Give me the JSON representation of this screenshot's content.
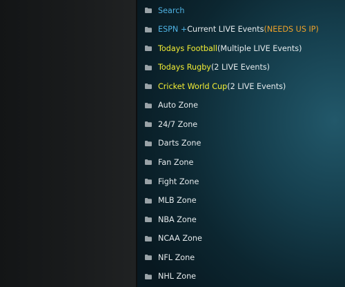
{
  "colors": {
    "blue": "#4fb3e4",
    "yellow": "#f4ee34",
    "white": "#e6ebed",
    "orange": "#eea22a"
  },
  "menu": {
    "items": [
      {
        "icon": "folder-icon",
        "segments": [
          {
            "text": "Search",
            "color": "blue"
          }
        ]
      },
      {
        "icon": "folder-icon",
        "segments": [
          {
            "text": "ESPN + ",
            "color": "blue"
          },
          {
            "text": "Current LIVE Events ",
            "color": "white"
          },
          {
            "text": "(NEEDS US IP)",
            "color": "orange"
          }
        ]
      },
      {
        "icon": "folder-icon",
        "segments": [
          {
            "text": "Todays Football",
            "color": "yellow"
          },
          {
            "text": " (Multiple LIVE Events)",
            "color": "white"
          }
        ]
      },
      {
        "icon": "folder-icon",
        "segments": [
          {
            "text": "Todays Rugby",
            "color": "yellow"
          },
          {
            "text": " (2 LIVE Events)",
            "color": "white"
          }
        ]
      },
      {
        "icon": "folder-icon",
        "segments": [
          {
            "text": "Cricket World Cup",
            "color": "yellow"
          },
          {
            "text": " (2 LIVE Events)",
            "color": "white"
          }
        ]
      },
      {
        "icon": "folder-icon",
        "segments": [
          {
            "text": "Auto Zone",
            "color": "white"
          }
        ]
      },
      {
        "icon": "folder-icon",
        "segments": [
          {
            "text": "24/7 Zone",
            "color": "white"
          }
        ]
      },
      {
        "icon": "folder-icon",
        "segments": [
          {
            "text": "Darts Zone",
            "color": "white"
          }
        ]
      },
      {
        "icon": "folder-icon",
        "segments": [
          {
            "text": "Fan Zone",
            "color": "white"
          }
        ]
      },
      {
        "icon": "folder-icon",
        "segments": [
          {
            "text": "Fight Zone",
            "color": "white"
          }
        ]
      },
      {
        "icon": "folder-icon",
        "segments": [
          {
            "text": "MLB Zone",
            "color": "white"
          }
        ]
      },
      {
        "icon": "folder-icon",
        "segments": [
          {
            "text": "NBA Zone",
            "color": "white"
          }
        ]
      },
      {
        "icon": "folder-icon",
        "segments": [
          {
            "text": "NCAA Zone",
            "color": "white"
          }
        ]
      },
      {
        "icon": "folder-icon",
        "segments": [
          {
            "text": "NFL Zone",
            "color": "white"
          }
        ]
      },
      {
        "icon": "folder-icon",
        "segments": [
          {
            "text": "NHL Zone",
            "color": "white"
          }
        ]
      }
    ]
  }
}
